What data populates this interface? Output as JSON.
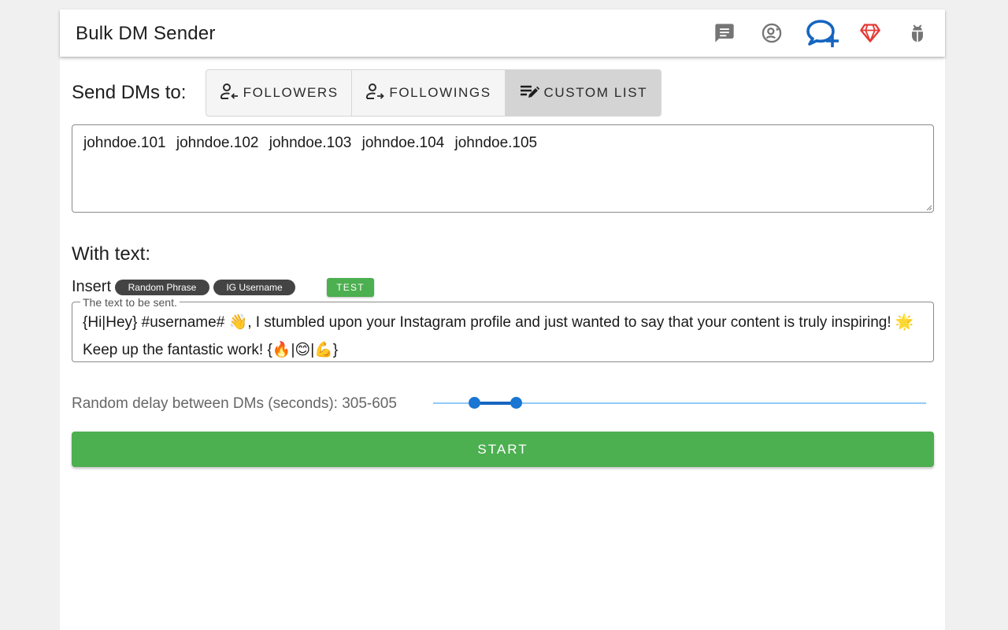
{
  "app": {
    "title": "Bulk DM Sender"
  },
  "toolbar": {
    "icons": [
      "chat-list-icon",
      "account-sync-icon",
      "message-plus-icon",
      "diamond-icon",
      "bug-icon"
    ]
  },
  "send_to": {
    "label": "Send DMs to:",
    "options": [
      {
        "label": "FOLLOWERS",
        "icon": "account-arrow-left-icon",
        "active": false
      },
      {
        "label": "FOLLOWINGS",
        "icon": "account-arrow-right-icon",
        "active": false
      },
      {
        "label": "CUSTOM LIST",
        "icon": "playlist-edit-icon",
        "active": true
      }
    ],
    "custom_list_value": "johndoe.101 johndoe.102 johndoe.103 johndoe.104 johndoe.105"
  },
  "message": {
    "heading": "With text:",
    "insert_label": "Insert",
    "chips": [
      "Random Phrase",
      "IG Username"
    ],
    "test_label": "TEST",
    "field_label": "The text to be sent.",
    "value": "{Hi|Hey} #username# 👋, I stumbled upon your Instagram profile and just wanted to say that your content is truly inspiring! 🌟 Keep up the fantastic work! {🔥|😊|💪}"
  },
  "delay": {
    "label": "Random delay between DMs (seconds): 305-605",
    "min_value": 305,
    "max_value": 605,
    "range_min_fraction": 0.083,
    "range_max_fraction": 0.167
  },
  "start": {
    "label": "START"
  },
  "colors": {
    "accent_green": "#4caf50",
    "slider_blue": "#1976d2",
    "icon_blue": "#1565c0",
    "diamond_red": "#e53935",
    "icon_gray": "#757575",
    "chip_dark": "#444444"
  }
}
